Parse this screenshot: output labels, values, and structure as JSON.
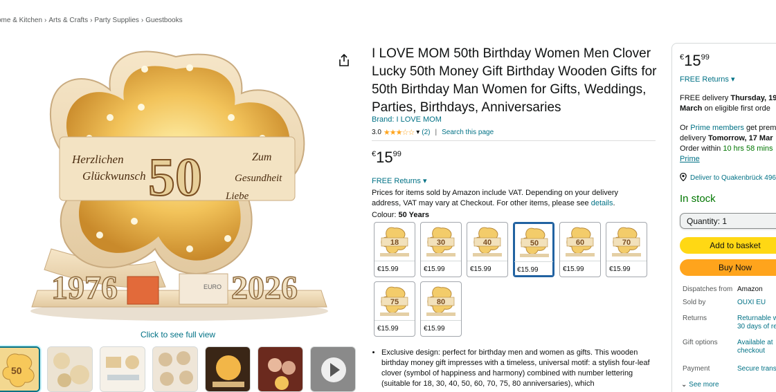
{
  "breadcrumb": [
    "ome & Kitchen",
    "Arts & Crafts",
    "Party Supplies",
    "Guestbooks"
  ],
  "breadcrumb_sep": "›",
  "media": {
    "see_full_view": "Click to see full view",
    "thumbnail_count": 8
  },
  "product": {
    "title": "I LOVE MOM 50th Birthday Women Men Clover Lucky 50th Money Gift Birthday Wooden Gifts for 50th Birthday Man Women for Gifts, Weddings, Parties, Birthdays, Anniversaries",
    "brand": "Brand: I LOVE MOM",
    "rating_value": "3.0",
    "stars": "★★★☆☆",
    "rating_chevron": "▾",
    "rating_count": "(2)",
    "rating_sep": "|",
    "search_page": "Search this page",
    "price_currency": "€",
    "price_whole": "15",
    "price_fraction": "99",
    "free_returns": "FREE Returns",
    "free_returns_chevron": "▾",
    "vat_text": "Prices for items sold by Amazon include VAT. Depending on your delivery address, VAT may vary at Checkout. For other items, please see ",
    "vat_link": "details",
    "vat_end": ".",
    "colour_label": "Colour: ",
    "colour_value": "50 Years",
    "swatches": [
      {
        "number": "18",
        "price": "€15.99",
        "selected": false
      },
      {
        "number": "30",
        "price": "€15.99",
        "selected": false
      },
      {
        "number": "40",
        "price": "€15.99",
        "selected": false
      },
      {
        "number": "50",
        "price": "€15.99",
        "selected": true
      },
      {
        "number": "60",
        "price": "€15.99",
        "selected": false
      },
      {
        "number": "70",
        "price": "€15.99",
        "selected": false
      },
      {
        "number": "75",
        "price": "€15.99",
        "selected": false
      },
      {
        "number": "80",
        "price": "€15.99",
        "selected": false
      }
    ],
    "bullet": "Exclusive design: perfect for birthday men and women as gifts. This wooden birthday money gift impresses with a timeless, universal motif: a stylish four-leaf clover (symbol of happiness and harmony) combined with number lettering (suitable for 18, 30, 40, 50, 60, 70, 75, 80 anniversaries), which"
  },
  "image_text": {
    "left_line1": "Herzlichen",
    "left_line2": "Glückwunsch",
    "number": "50",
    "right_line1": "Zum",
    "right_line2": "Gesundheit",
    "right_line3": "Liebe",
    "year_left": "1976",
    "year_right": "2026",
    "note_text": "EURO"
  },
  "buybox": {
    "price_currency": "€",
    "price_whole": "15",
    "price_fraction": "99",
    "free_returns": "FREE Returns",
    "delivery_prefix": "FREE delivery ",
    "delivery_date": "Thursday, 19",
    "delivery_line2_bold": "March",
    "delivery_line2_rest": " on eligible first orde",
    "prime_or": "Or ",
    "prime_members": "Prime members",
    "prime_get": " get prem",
    "prime_delivery": "delivery ",
    "prime_date": "Tomorrow, 17 Mar",
    "prime_order": "Order within ",
    "prime_time": "10 hrs 58 mins",
    "prime_link": "Prime",
    "deliver_to": "Deliver to Quakenbrück 496",
    "in_stock": "In stock",
    "quantity": "Quantity: 1",
    "add_to_basket": "Add to basket",
    "buy_now": "Buy Now",
    "dispatches_label": "Dispatches from",
    "dispatches_value": "Amazon",
    "sold_by_label": "Sold by",
    "sold_by_value": "OUXI EU",
    "returns_label": "Returns",
    "returns_value_1": "Returnable w",
    "returns_value_2": "30 days of re",
    "gift_label": "Gift options",
    "gift_value_1": "Available at",
    "gift_value_2": "checkout",
    "payment_label": "Payment",
    "payment_value": "Secure transa",
    "see_more": "See more"
  },
  "colors": {
    "link": "#007185",
    "add_basket": "#ffd814",
    "buy_now": "#ffa41c",
    "in_stock": "#007600",
    "selected_swatch": "#2162a1"
  }
}
